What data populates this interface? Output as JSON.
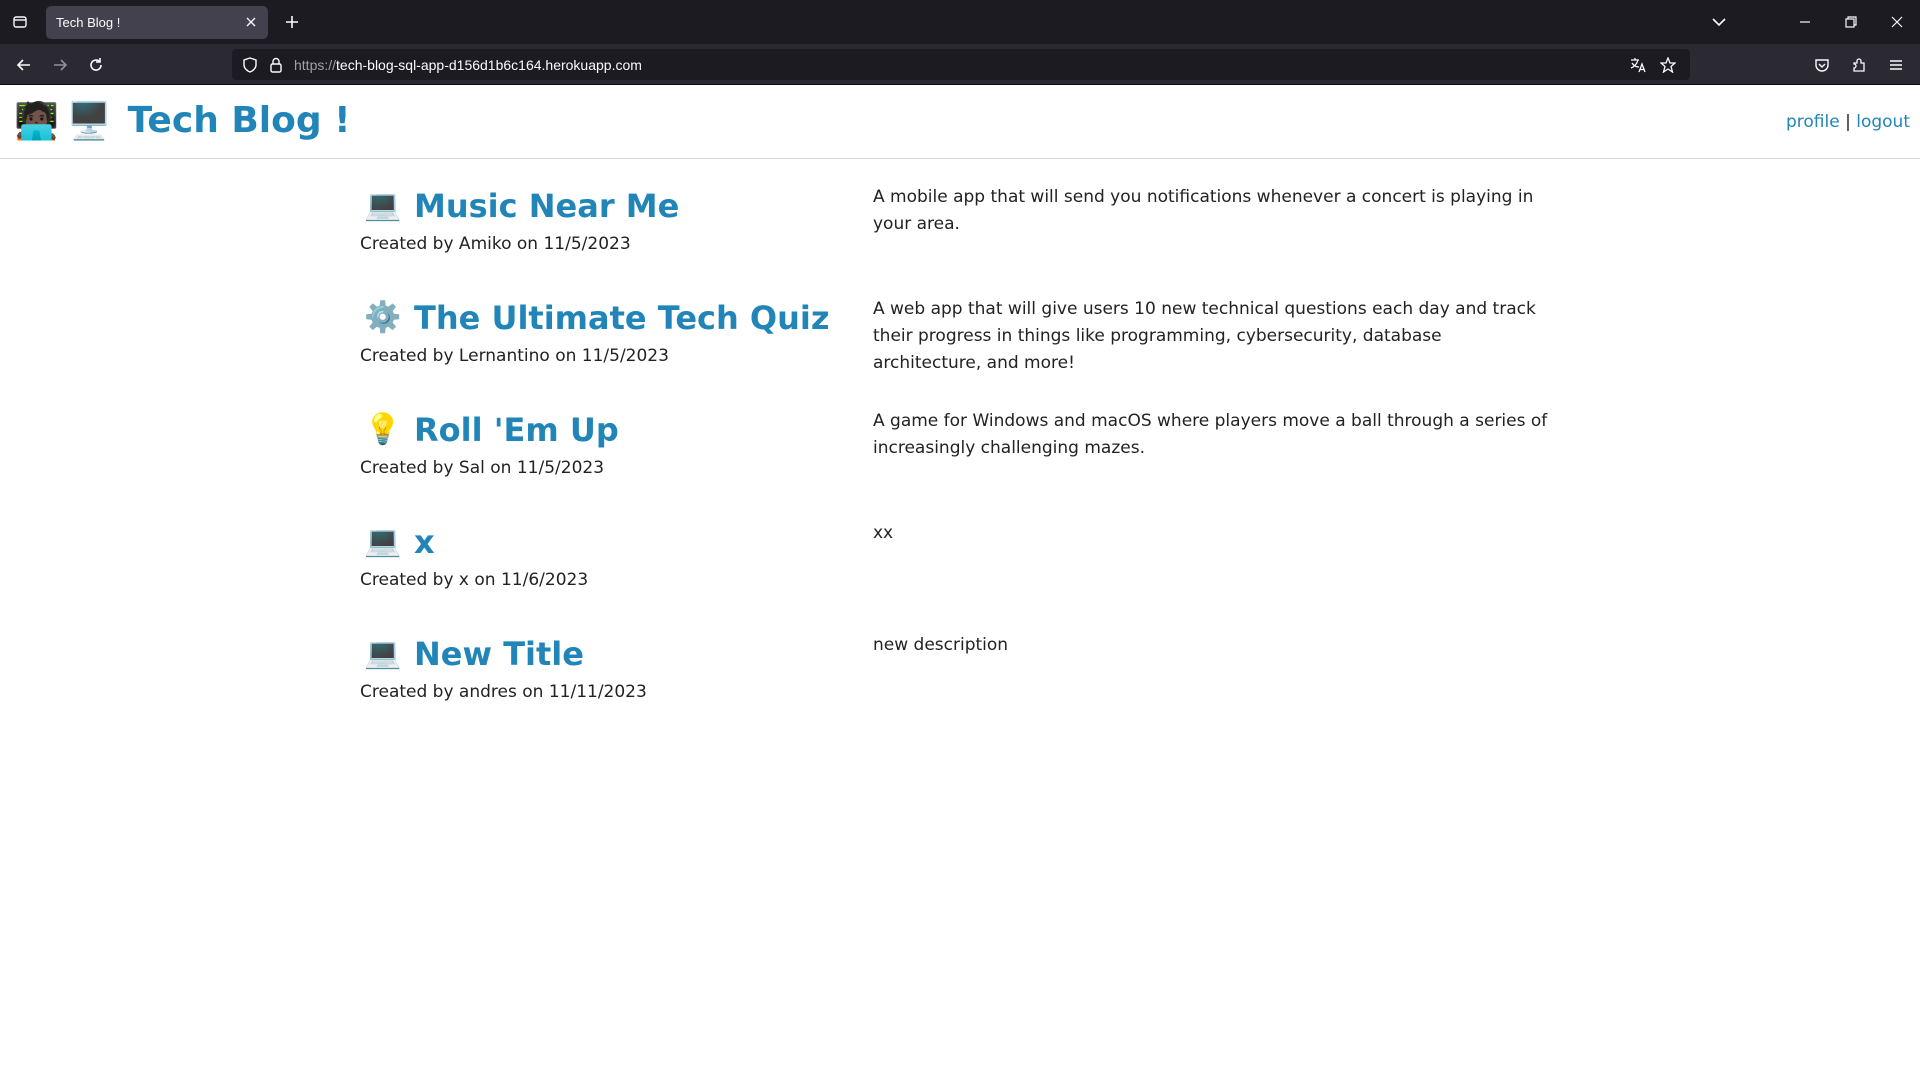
{
  "browser": {
    "tab_title": "Tech Blog !",
    "url_scheme": "https://",
    "url_host": "tech-blog-sql-app-d156d1b6c164.herokuapp.com"
  },
  "header": {
    "logo_emoji_person": "🧑🏿‍💻",
    "logo_emoji_computer": "🖥️",
    "title": "Tech Blog !",
    "profile_label": "profile",
    "separator": "|",
    "logout_label": "logout"
  },
  "posts": [
    {
      "emoji": "💻",
      "title": "Music Near Me",
      "meta": "Created by Amiko on 11/5/2023",
      "description": "A mobile app that will send you notifications whenever a concert is playing in your area."
    },
    {
      "emoji": "⚙️",
      "title": "The Ultimate Tech Quiz",
      "meta": "Created by Lernantino on 11/5/2023",
      "description": "A web app that will give users 10 new technical questions each day and track their progress in things like programming, cybersecurity, database architecture, and more!"
    },
    {
      "emoji": "💡",
      "title": "Roll 'Em Up",
      "meta": "Created by Sal on 11/5/2023",
      "description": "A game for Windows and macOS where players move a ball through a series of increasingly challenging mazes."
    },
    {
      "emoji": "💻",
      "title": "x",
      "meta": "Created by x on 11/6/2023",
      "description": "xx"
    },
    {
      "emoji": "💻",
      "title": "New Title",
      "meta": "Created by andres on 11/11/2023",
      "description": "new description"
    }
  ]
}
